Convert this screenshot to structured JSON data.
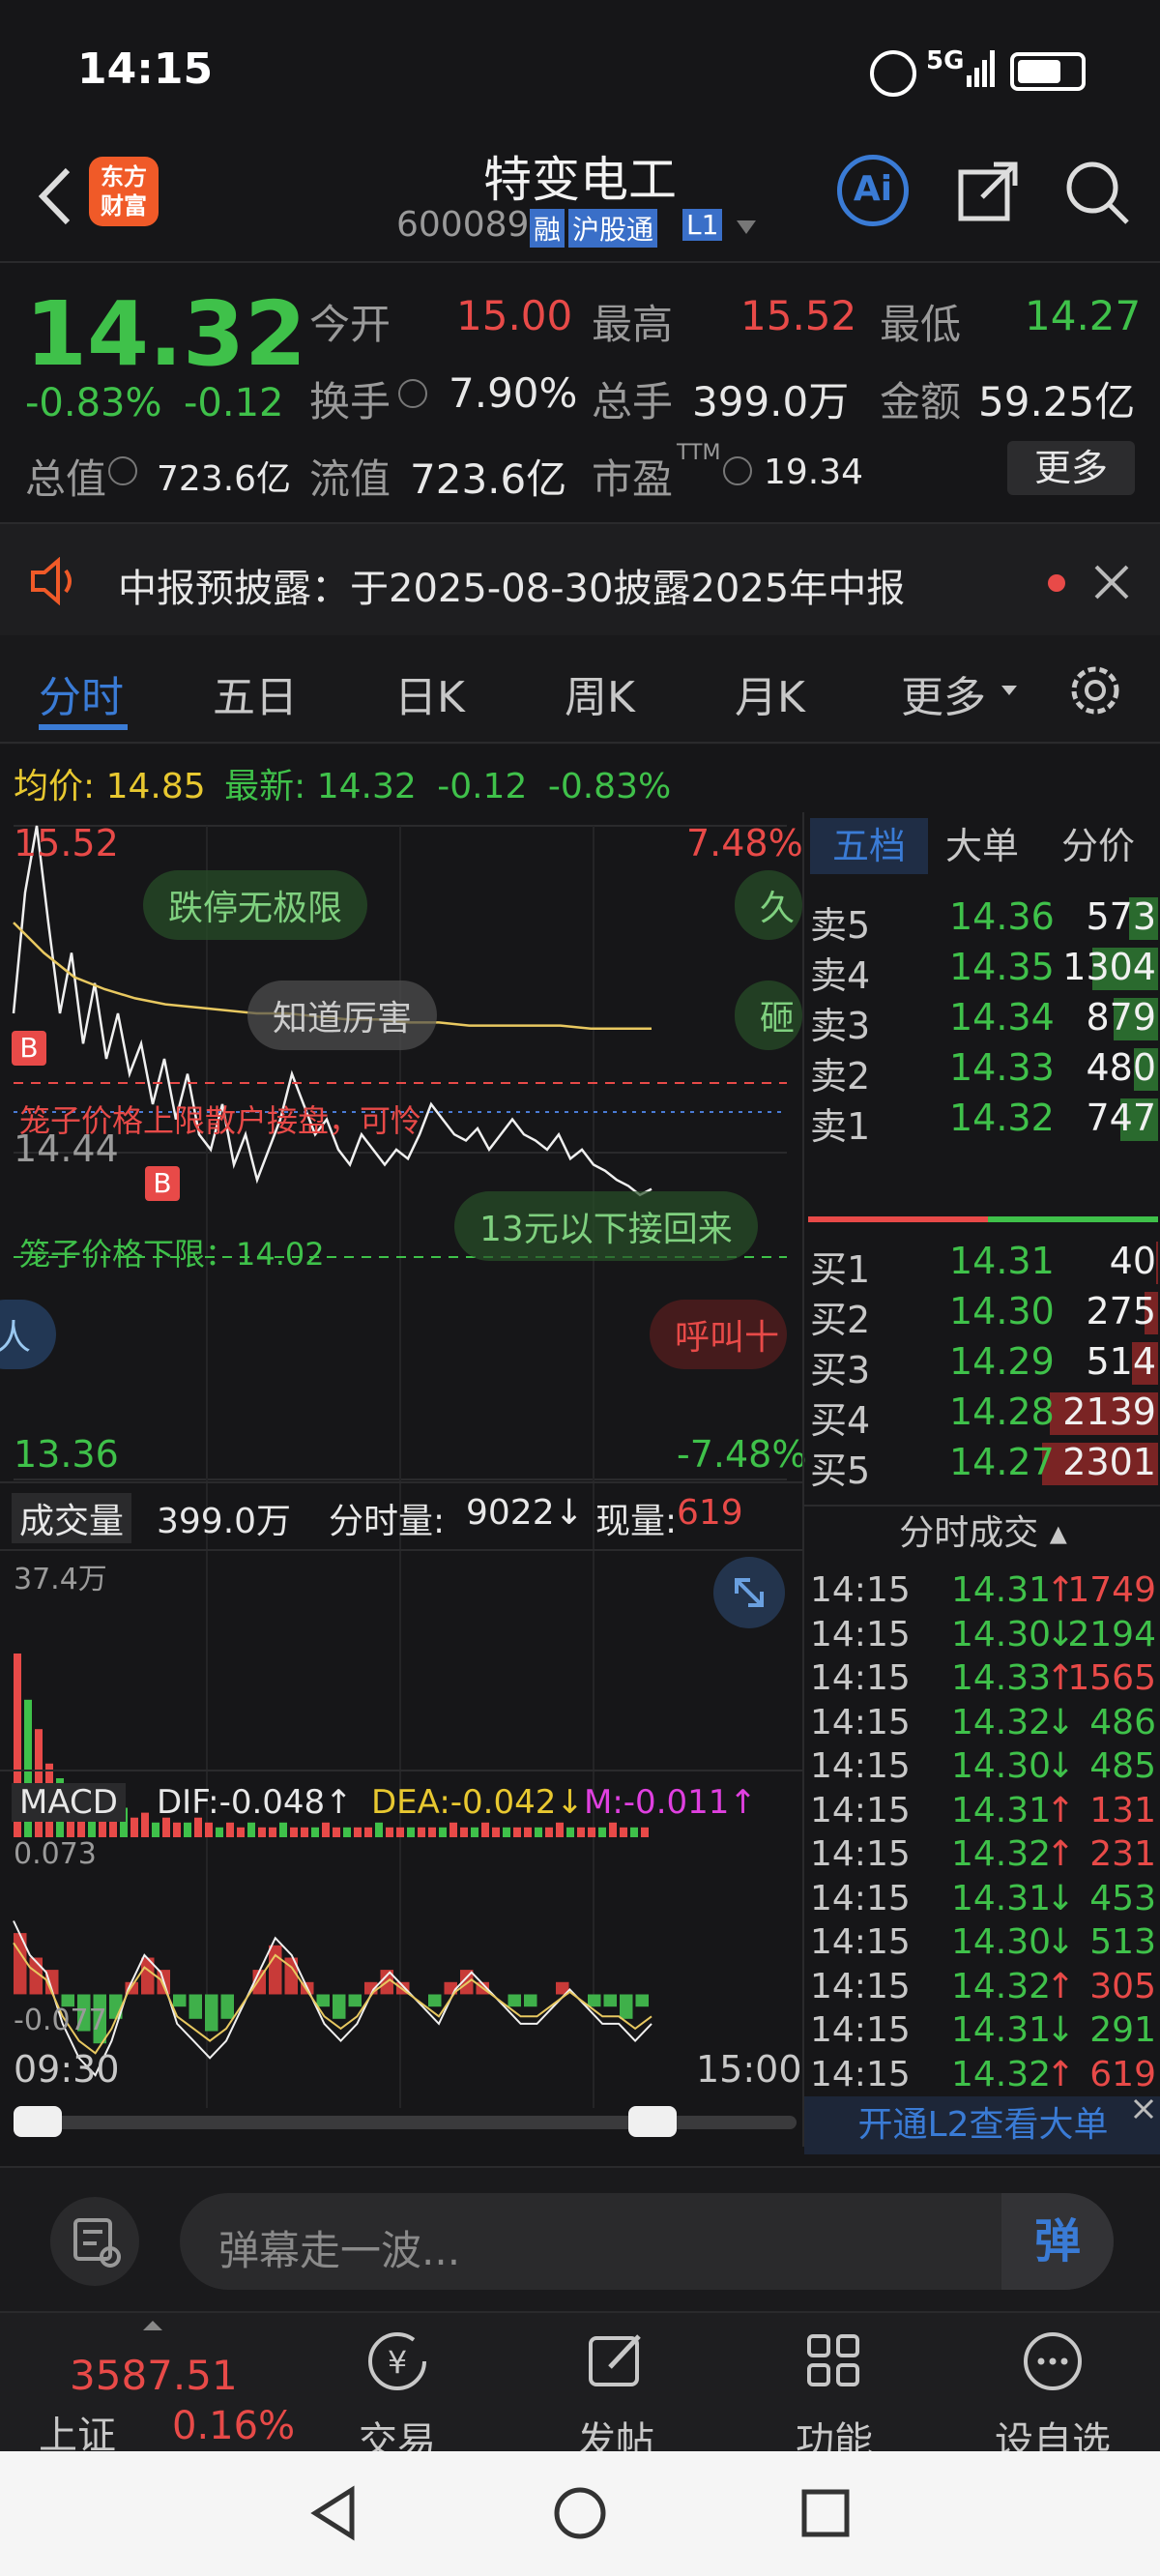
{
  "status_bar": {
    "time": "14:15",
    "network": "5G"
  },
  "header": {
    "brand_line1": "东方",
    "brand_line2": "财富",
    "stock_name": "特变电工",
    "stock_code": "600089",
    "tag_margin": "融",
    "tag_connect": "沪股通",
    "tag_level": "L1",
    "ai_label": "Ai"
  },
  "quote": {
    "price": "14.32",
    "change_pct": "-0.83%",
    "change": "-0.12",
    "open_label": "今开",
    "open": "15.00",
    "high_label": "最高",
    "high": "15.52",
    "low_label": "最低",
    "low": "14.27",
    "turnover_label": "换手",
    "turnover": "7.90%",
    "volume_label": "总手",
    "volume": "399.0万",
    "amount_label": "金额",
    "amount": "59.25亿",
    "mcap_label": "总值",
    "mcap": "723.6亿",
    "float_label": "流值",
    "float": "723.6亿",
    "pe_label": "市盈",
    "pe_sup": "TTM",
    "pe": "19.34",
    "more_button": "更多"
  },
  "notice": {
    "text": "中报预披露：于2025-08-30披露2025年中报"
  },
  "tabs": [
    "分时",
    "五日",
    "日K",
    "周K",
    "月K",
    "更多"
  ],
  "chart_header": {
    "avg_label": "均价:",
    "avg": "14.85",
    "latest_label": "最新:",
    "latest": "14.32",
    "latest_change": "-0.12",
    "latest_pct": "-0.83%"
  },
  "chart_data": [
    {
      "type": "line",
      "name": "intraday",
      "ylim": [
        13.36,
        15.52
      ],
      "pct_range": [
        "7.48%",
        "-7.48%"
      ],
      "y_high_label": "15.52",
      "y_low_label": "13.36",
      "y_mid_label": "14.44",
      "x_start_label": "09:30",
      "x_end_label": "15:00",
      "series": [
        {
          "values": [
            14.9,
            15.3,
            15.52,
            15.2,
            14.9,
            15.1,
            14.8,
            15.0,
            14.75,
            14.9,
            14.7,
            14.8,
            14.6,
            14.75,
            14.55,
            14.7,
            14.5,
            14.45,
            14.6,
            14.4,
            14.5,
            14.35,
            14.45,
            14.55,
            14.7,
            14.6,
            14.5,
            14.55,
            14.45,
            14.4,
            14.5,
            14.45,
            14.4,
            14.45,
            14.42,
            14.5,
            14.6,
            14.55,
            14.5,
            14.48,
            14.52,
            14.45,
            14.5,
            14.55,
            14.5,
            14.48,
            14.45,
            14.5,
            14.42,
            14.45,
            14.4,
            14.38,
            14.35,
            14.33,
            14.3,
            14.32
          ]
        },
        {
          "values": [
            15.2,
            15.1,
            15.02,
            14.98,
            14.95,
            14.93,
            14.92,
            14.91,
            14.9,
            14.9,
            14.89,
            14.88,
            14.88,
            14.87,
            14.87,
            14.86,
            14.86,
            14.86,
            14.86,
            14.85,
            14.85,
            14.85
          ]
        }
      ]
    },
    {
      "type": "bar",
      "name": "volume",
      "ylim": [
        0,
        37.4
      ],
      "values": [
        37.4,
        28,
        22,
        15,
        12,
        10,
        9,
        8,
        6,
        5,
        6,
        4,
        5,
        3,
        4,
        3,
        3,
        4,
        3,
        2,
        3,
        2,
        3,
        2,
        2,
        3,
        2,
        2,
        2,
        3,
        2,
        2,
        2,
        2,
        3,
        2,
        2,
        2,
        2,
        2,
        2,
        3,
        2,
        2,
        3,
        2,
        2,
        2,
        2,
        2,
        2,
        3,
        2,
        2,
        2,
        2,
        3,
        2,
        2,
        2
      ]
    },
    {
      "type": "bar",
      "name": "macd",
      "ylim": [
        -0.077,
        0.073
      ],
      "values": [
        0.05,
        0.03,
        0.02,
        -0.01,
        -0.03,
        -0.04,
        -0.02,
        0.01,
        0.03,
        0.02,
        -0.01,
        -0.02,
        -0.03,
        -0.02,
        0.0,
        0.02,
        0.04,
        0.03,
        0.01,
        -0.01,
        -0.02,
        -0.01,
        0.01,
        0.02,
        0.01,
        0.0,
        -0.01,
        0.01,
        0.02,
        0.01,
        0.0,
        -0.01,
        -0.01,
        0.0,
        0.01,
        0.0,
        -0.01,
        -0.01,
        -0.02,
        -0.01
      ]
    }
  ],
  "overlays": {
    "label_cage_upper": "笼子价格上限散户接盘，可怜",
    "label_cage_lower": "笼子价格下限：14.02",
    "danmaku": [
      "跌停无极限",
      "知道厉害",
      "13元以下接回来",
      "呼叫十",
      "久",
      "砸",
      "人"
    ],
    "buy_marker": "B"
  },
  "orderbook": {
    "tabs": [
      "五档",
      "大单",
      "分价"
    ],
    "sells": [
      {
        "label": "卖5",
        "price": "14.36",
        "vol": "573"
      },
      {
        "label": "卖4",
        "price": "14.35",
        "vol": "1304"
      },
      {
        "label": "卖3",
        "price": "14.34",
        "vol": "879"
      },
      {
        "label": "卖2",
        "price": "14.33",
        "vol": "480"
      },
      {
        "label": "卖1",
        "price": "14.32",
        "vol": "747"
      }
    ],
    "buys": [
      {
        "label": "买1",
        "price": "14.31",
        "vol": "40"
      },
      {
        "label": "买2",
        "price": "14.30",
        "vol": "275"
      },
      {
        "label": "买3",
        "price": "14.29",
        "vol": "514"
      },
      {
        "label": "买4",
        "price": "14.28",
        "vol": "2139"
      },
      {
        "label": "买5",
        "price": "14.27",
        "vol": "2301"
      }
    ]
  },
  "ticks": {
    "title": "分时成交",
    "rows": [
      {
        "time": "14:15",
        "price": "14.31",
        "dir": "↑",
        "vol": "1749",
        "c": "red"
      },
      {
        "time": "14:15",
        "price": "14.30",
        "dir": "↓",
        "vol": "2194",
        "c": "green"
      },
      {
        "time": "14:15",
        "price": "14.33",
        "dir": "↑",
        "vol": "1565",
        "c": "red"
      },
      {
        "time": "14:15",
        "price": "14.32",
        "dir": "↓",
        "vol": "486",
        "c": "green"
      },
      {
        "time": "14:15",
        "price": "14.30",
        "dir": "↓",
        "vol": "485",
        "c": "green"
      },
      {
        "time": "14:15",
        "price": "14.31",
        "dir": "↑",
        "vol": "131",
        "c": "red"
      },
      {
        "time": "14:15",
        "price": "14.32",
        "dir": "↑",
        "vol": "231",
        "c": "red"
      },
      {
        "time": "14:15",
        "price": "14.31",
        "dir": "↓",
        "vol": "453",
        "c": "green"
      },
      {
        "time": "14:15",
        "price": "14.30",
        "dir": "↓",
        "vol": "513",
        "c": "green"
      },
      {
        "time": "14:15",
        "price": "14.32",
        "dir": "↑",
        "vol": "305",
        "c": "red"
      },
      {
        "time": "14:15",
        "price": "14.31",
        "dir": "↓",
        "vol": "291",
        "c": "green"
      },
      {
        "time": "14:15",
        "price": "14.32",
        "dir": "↑",
        "vol": "619",
        "c": "red"
      }
    ],
    "l2_banner": "开通L2查看大单"
  },
  "volume_panel": {
    "label": "成交量",
    "total": "399.0万",
    "tick_label": "分时量:",
    "tick_val": "9022↓",
    "now_label": "现量:",
    "now_val": "619",
    "max_label": "37.4万"
  },
  "macd_panel": {
    "label": "MACD",
    "dif": "DIF:-0.048↑",
    "dea": "DEA:-0.042↓",
    "m": "M:-0.011↑",
    "max_label": "0.073",
    "min_label": "-0.077"
  },
  "comment_box": {
    "placeholder": "弹幕走一波...",
    "send": "弹"
  },
  "bottom_nav": {
    "index_value": "3587.51",
    "index_name": "上证",
    "index_pct": "0.16%",
    "items": [
      "交易",
      "发帖",
      "功能",
      "设自选"
    ]
  },
  "colors": {
    "up": "#e84a48",
    "down": "#3fc14a",
    "accent": "#3a7bd5",
    "bg": "#161618"
  }
}
